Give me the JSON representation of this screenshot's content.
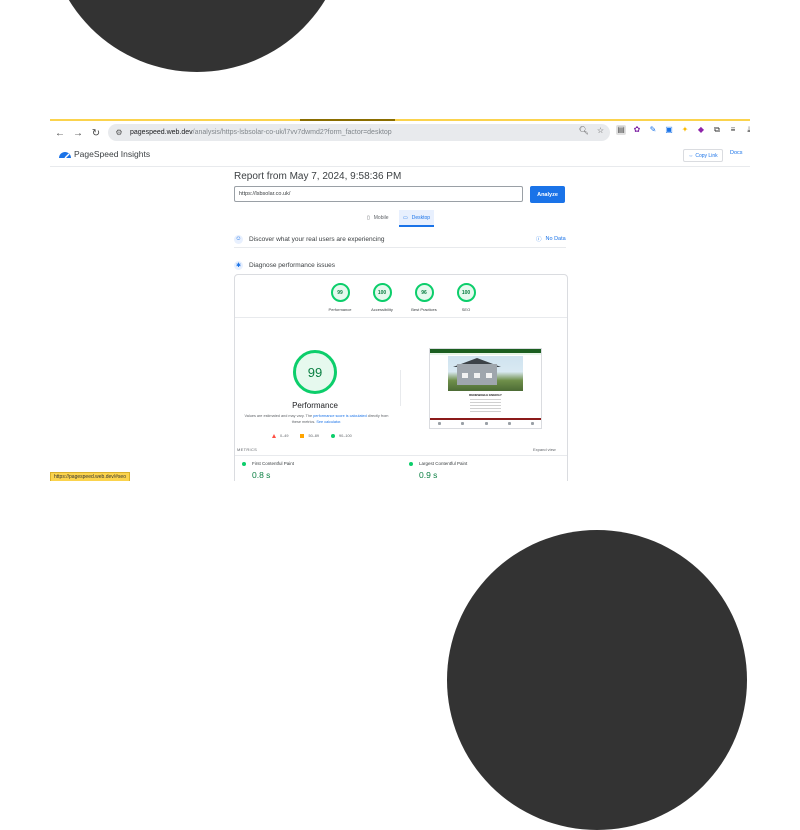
{
  "browser": {
    "url_host": "pagespeed.web.dev",
    "url_path": "/analysis/https-lsbsolar-co-uk/l7vv7dwmd2?form_factor=desktop",
    "status_url": "https://pagespeed.web.dev/#seo"
  },
  "psi": {
    "title": "PageSpeed Insights",
    "copy_link": "Copy Link",
    "docs": "Docs",
    "report_title": "Report from May 7, 2024, 9:58:36 PM",
    "input_value": "https://lsbsolar.co.uk/",
    "analyze": "Analyze",
    "tabs": {
      "mobile": "Mobile",
      "desktop": "Desktop"
    },
    "field_section": "Discover what your real users are experiencing",
    "no_data": "No Data",
    "diagnose_section": "Diagnose performance issues"
  },
  "scores": [
    {
      "value": "99",
      "label": "Performance"
    },
    {
      "value": "100",
      "label": "Accessibility"
    },
    {
      "value": "96",
      "label": "Best Practices"
    },
    {
      "value": "100",
      "label": "SEO"
    }
  ],
  "performance": {
    "score": "99",
    "title": "Performance",
    "desc_1": "Values are estimated and may vary. The ",
    "desc_link_1": "performance score is calculated",
    "desc_2": " directly from these metrics. ",
    "desc_link_2": "See calculator.",
    "legend": {
      "poor": "0–49",
      "average": "50–89",
      "good": "90–100"
    }
  },
  "preview": {
    "title": "RENEWABLE ENERGY"
  },
  "metrics": {
    "label": "METRICS",
    "expand": "Expand view",
    "fcp_name": "First Contentful Paint",
    "fcp_value": "0.8 s",
    "lcp_name": "Largest Contentful Paint",
    "lcp_value": "0.9 s"
  },
  "colors": {
    "good": "#0cce6b",
    "average": "#ffa400",
    "poor": "#ff4e42",
    "accent": "#1a73e8"
  }
}
